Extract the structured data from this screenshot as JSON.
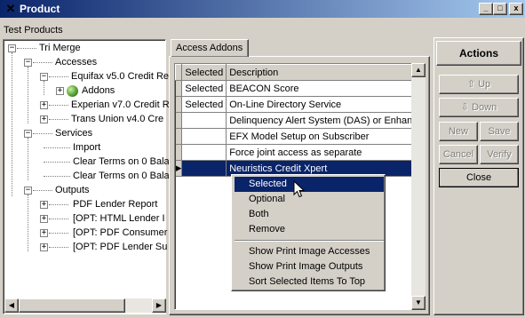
{
  "window": {
    "title": "Product",
    "app_icon": "x-icon",
    "caption_buttons": [
      "_",
      "□",
      "x"
    ]
  },
  "subtitle": "Test Products",
  "tree": {
    "nodes": [
      {
        "label": "Tri Merge"
      },
      {
        "label": "Accesses"
      },
      {
        "label": "Equifax v5.0 Credit Re"
      },
      {
        "label": "Addons"
      },
      {
        "label": "Experian v7.0 Credit R"
      },
      {
        "label": "Trans Union v4.0 Cre"
      },
      {
        "label": "Services"
      },
      {
        "label": "Import"
      },
      {
        "label": "Clear Terms on 0 Bala"
      },
      {
        "label": "Clear Terms on 0 Bala"
      },
      {
        "label": "Outputs"
      },
      {
        "label": "PDF Lender Report"
      },
      {
        "label": "[OPT: HTML Lender I"
      },
      {
        "label": "[OPT: PDF Consumer"
      },
      {
        "label": "[OPT: PDF Lender Su"
      }
    ]
  },
  "tab": {
    "label": "Access Addons"
  },
  "grid": {
    "columns": [
      "Selected",
      "Description"
    ],
    "rows": [
      {
        "selected": "Selected",
        "description": "BEACON Score"
      },
      {
        "selected": "Selected",
        "description": "On-Line Directory Service"
      },
      {
        "selected": "",
        "description": "Delinquency Alert System (DAS) or Enhan"
      },
      {
        "selected": "",
        "description": "EFX Model Setup on Subscriber"
      },
      {
        "selected": "",
        "description": "Force joint access as separate"
      },
      {
        "selected": "",
        "description": "Neuristics Credit Xpert"
      }
    ],
    "current_row_indicator": "▶"
  },
  "context_menu": {
    "items": [
      "Selected",
      "Optional",
      "Both",
      "Remove"
    ],
    "items2": [
      "Show Print Image Accesses",
      "Show Print Image Outputs",
      "Sort Selected Items To Top"
    ]
  },
  "actions": {
    "title": "Actions",
    "up": "Up",
    "down": "Down",
    "new": "New",
    "save": "Save",
    "cancel": "Cancel",
    "verify": "Verify",
    "close": "Close"
  },
  "colors": {
    "selection": "#0a246a",
    "face": "#d4d0c8"
  }
}
